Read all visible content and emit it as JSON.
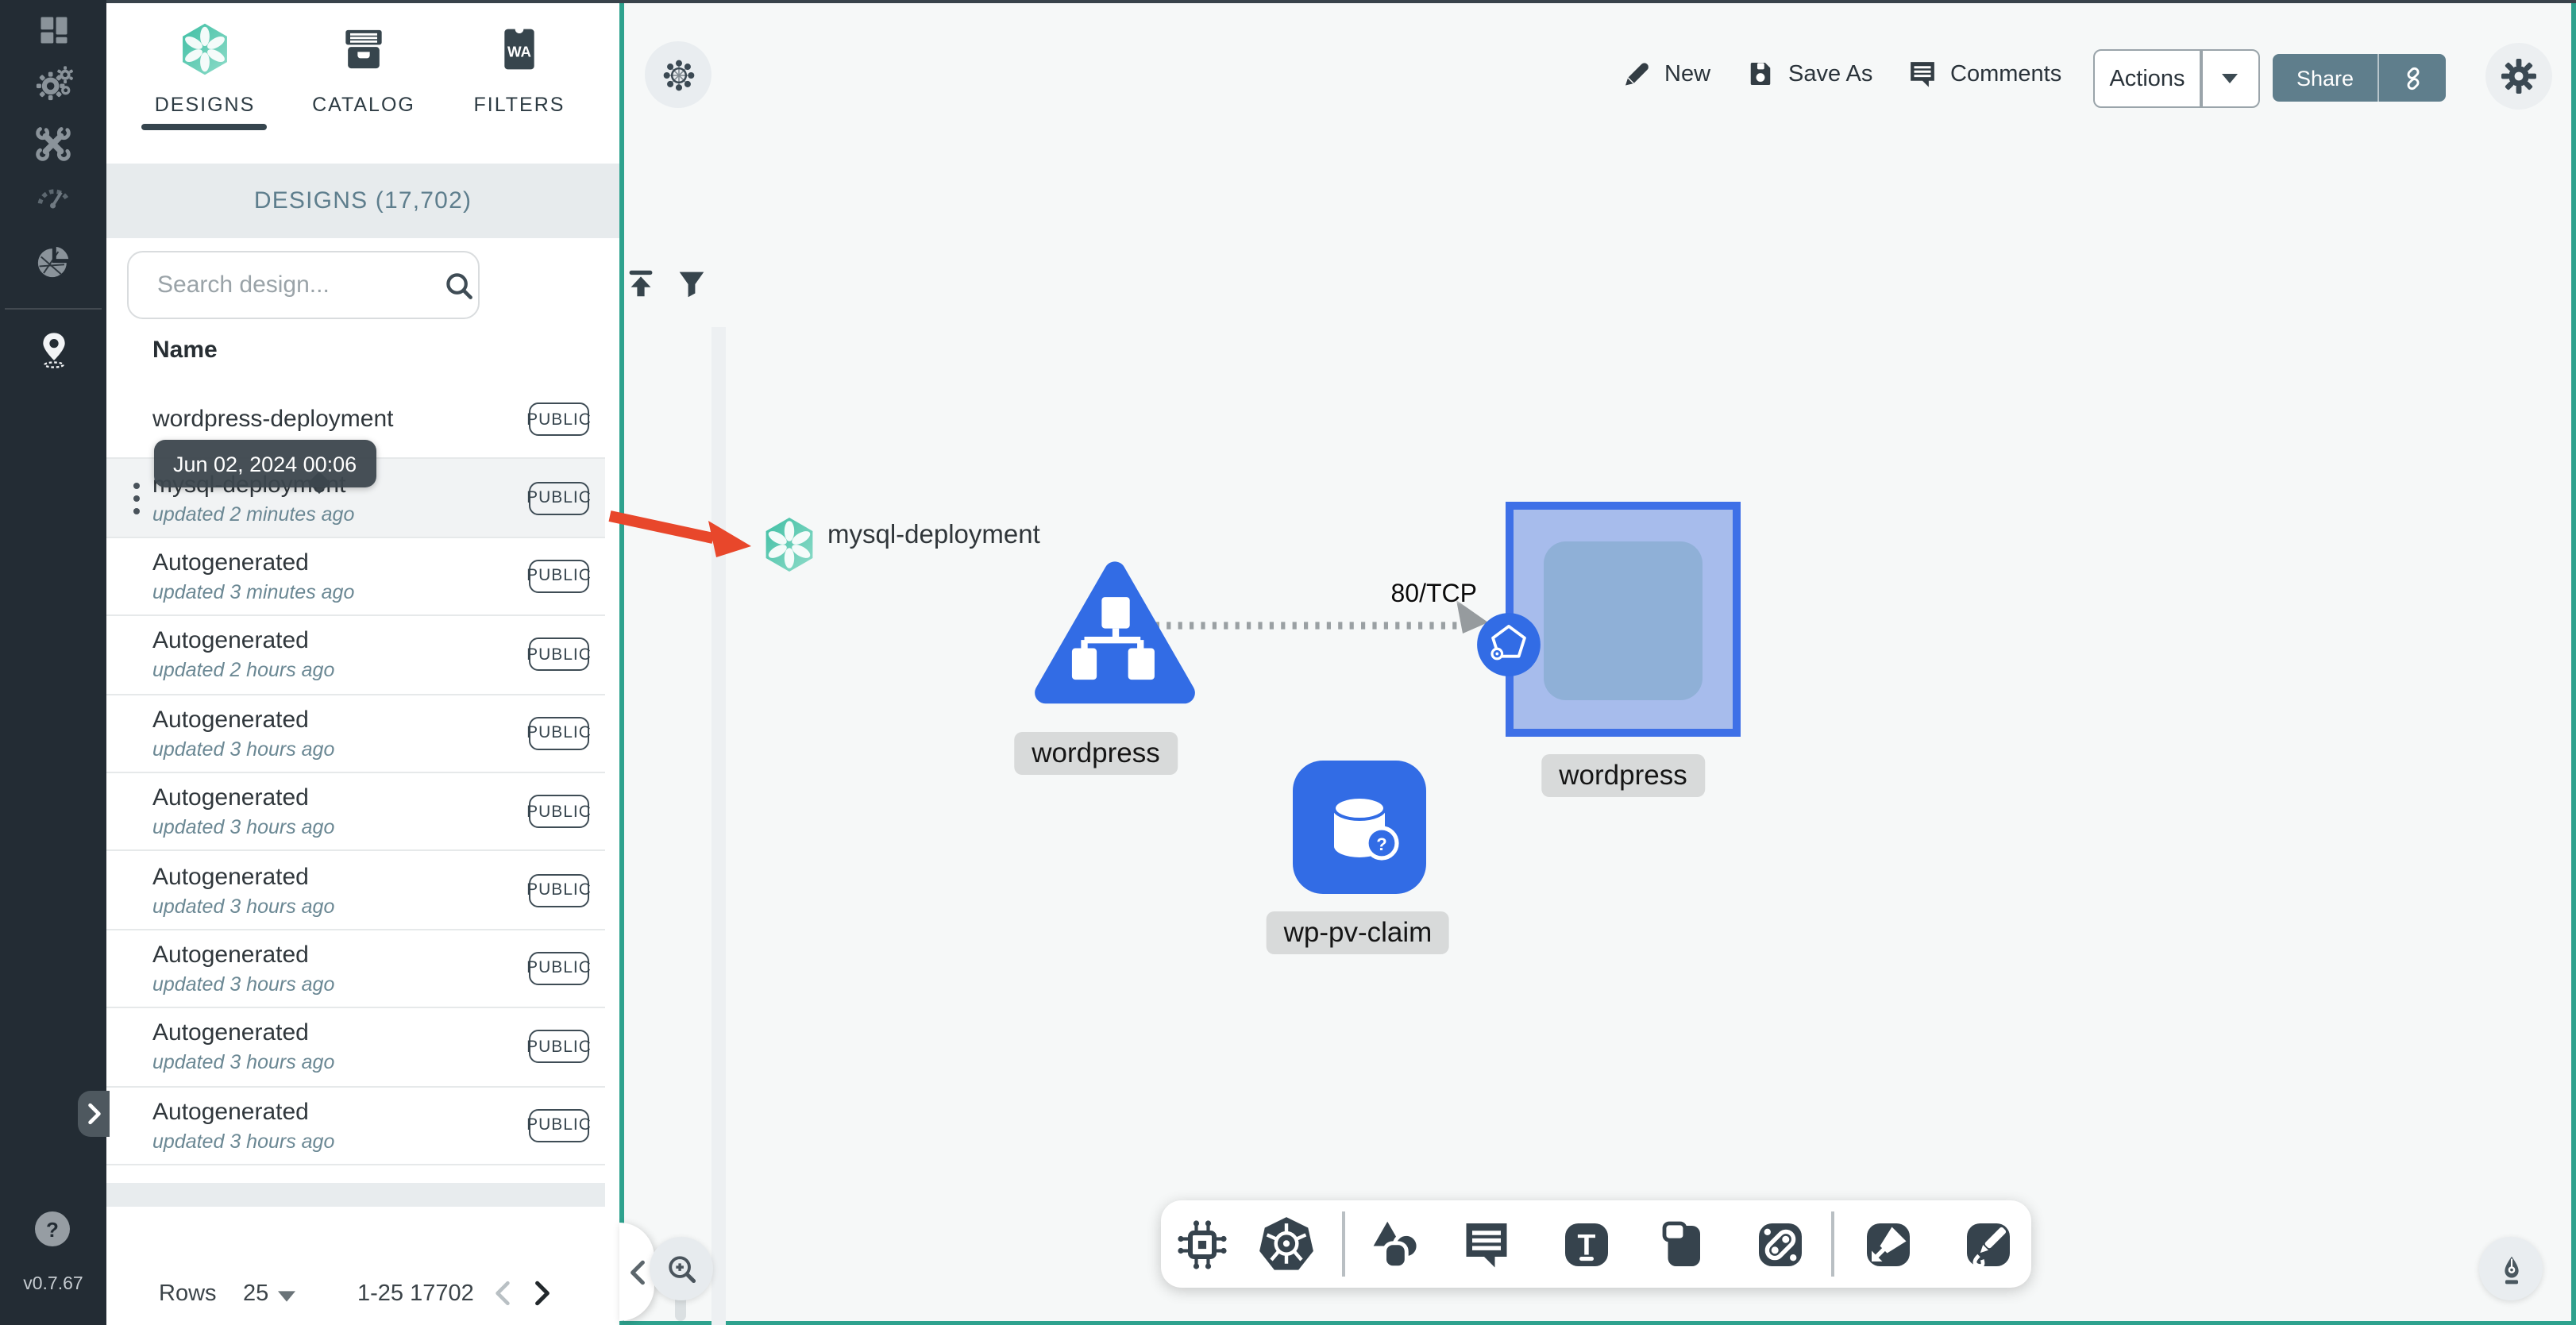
{
  "app": {
    "version": "v0.7.67"
  },
  "sidebar": {
    "items": [
      {
        "name": "dashboard"
      },
      {
        "name": "lifecycle"
      },
      {
        "name": "configuration"
      },
      {
        "name": "performance"
      },
      {
        "name": "extensions"
      },
      {
        "name": "kanvas"
      }
    ]
  },
  "panel": {
    "tabs": [
      {
        "label": "DESIGNS"
      },
      {
        "label": "CATALOG"
      },
      {
        "label": "FILTERS",
        "badge_text": "WA"
      }
    ],
    "header": "DESIGNS (17,702)",
    "search": {
      "placeholder": "Search design..."
    },
    "columns": {
      "name": "Name"
    },
    "tooltip": "Jun 02, 2024 00:06",
    "rows": [
      {
        "name": "wordpress-deployment",
        "updated": "",
        "badge": "PUBLIC",
        "selected": false
      },
      {
        "name": "mysql-deployment",
        "updated": "updated 2 minutes ago",
        "badge": "PUBLIC",
        "selected": true
      },
      {
        "name": "Autogenerated",
        "updated": "updated 3 minutes ago",
        "badge": "PUBLIC",
        "selected": false
      },
      {
        "name": "Autogenerated",
        "updated": "updated 2 hours ago",
        "badge": "PUBLIC",
        "selected": false
      },
      {
        "name": "Autogenerated",
        "updated": "updated 3 hours ago",
        "badge": "PUBLIC",
        "selected": false
      },
      {
        "name": "Autogenerated",
        "updated": "updated 3 hours ago",
        "badge": "PUBLIC",
        "selected": false
      },
      {
        "name": "Autogenerated",
        "updated": "updated 3 hours ago",
        "badge": "PUBLIC",
        "selected": false
      },
      {
        "name": "Autogenerated",
        "updated": "updated 3 hours ago",
        "badge": "PUBLIC",
        "selected": false
      },
      {
        "name": "Autogenerated",
        "updated": "updated 3 hours ago",
        "badge": "PUBLIC",
        "selected": false
      },
      {
        "name": "Autogenerated",
        "updated": "updated 3 hours ago",
        "badge": "PUBLIC",
        "selected": false
      }
    ],
    "pagination": {
      "rows_label": "Rows",
      "per_page": "25",
      "range": "1-25 17702"
    }
  },
  "topbar": {
    "new": "New",
    "save_as": "Save As",
    "comments": "Comments",
    "actions": "Actions",
    "share": "Share"
  },
  "canvas": {
    "nodes": {
      "mysql": {
        "label": "mysql-deployment"
      },
      "wordpress_service": {
        "label": "wordpress"
      },
      "wordpress_deployment": {
        "label": "wordpress"
      },
      "wp_pv_claim": {
        "label": "wp-pv-claim"
      }
    },
    "edge": {
      "label": "80/TCP"
    },
    "text_tool_glyph": "T"
  },
  "colors": {
    "teal_accent": "#2ea28e",
    "kubernetes_blue": "#326CE5",
    "selected_border_blue": "#3e70e7",
    "red_annotation": "#e8472b",
    "sidebar_dark": "#232c34",
    "share_slate": "#5f7e8c"
  }
}
